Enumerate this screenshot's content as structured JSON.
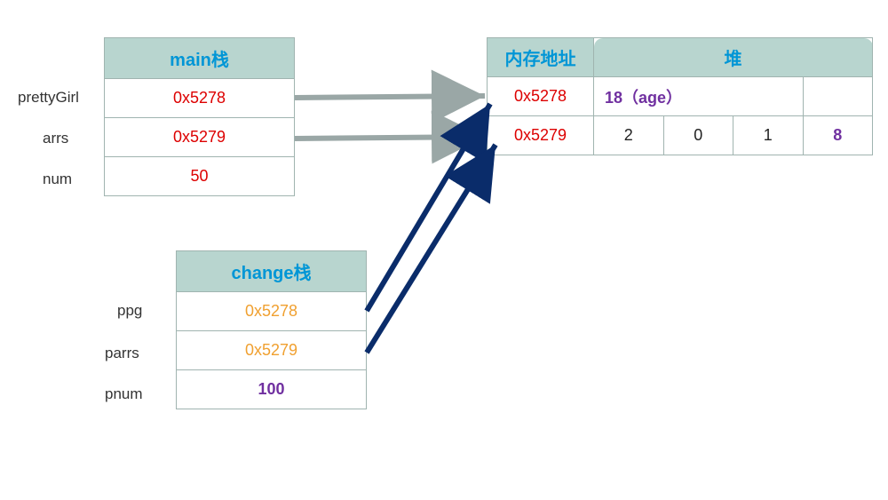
{
  "mainStack": {
    "title": "main栈",
    "rows": [
      {
        "label": "prettyGirl",
        "value": "0x5278"
      },
      {
        "label": "arrs",
        "value": "0x5279"
      },
      {
        "label": "num",
        "value": "50"
      }
    ]
  },
  "changeStack": {
    "title": "change栈",
    "rows": [
      {
        "label": "ppg",
        "value": "0x5278"
      },
      {
        "label": "parrs",
        "value": "0x5279"
      },
      {
        "label": "pnum",
        "value": "100"
      }
    ]
  },
  "heap": {
    "addrHeader": "内存地址",
    "heapHeader": "堆",
    "rows": [
      {
        "addr": "0x5278",
        "cells": [
          "18（age）",
          "",
          "",
          ""
        ],
        "mergeFirst": 3
      },
      {
        "addr": "0x5279",
        "cells": [
          "2",
          "0",
          "1",
          "8"
        ]
      }
    ]
  },
  "colors": {
    "headerBg": "#b8d5cf",
    "headerText": "#0096d6",
    "addrRed": "#d00",
    "valuePurple": "#7030a0",
    "changeOrange": "#f0a030",
    "arrowGray": "#9aa7a6",
    "arrowNavy": "#0a2c6a"
  }
}
